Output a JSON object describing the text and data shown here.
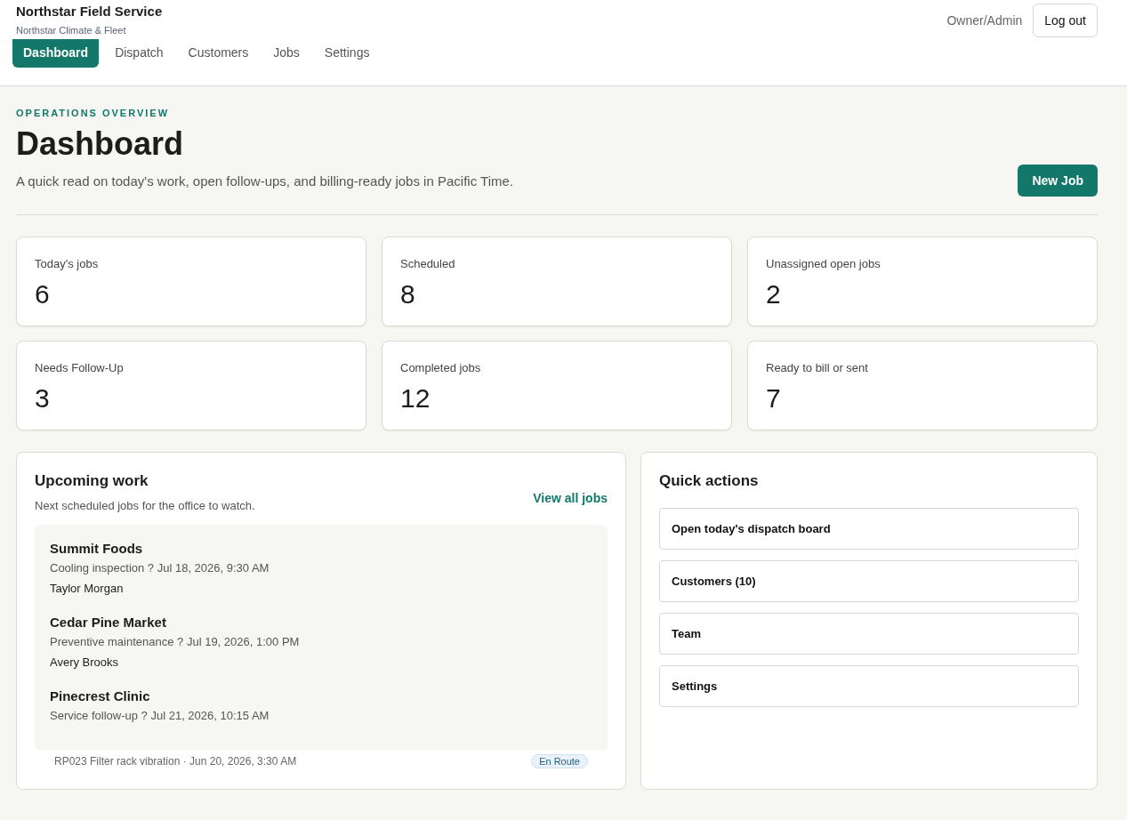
{
  "brand": {
    "title": "Northstar Field Service",
    "subtitle": "Northstar Climate & Fleet"
  },
  "user": {
    "role": "Owner/Admin",
    "logout": "Log out"
  },
  "nav": [
    {
      "label": "Dashboard",
      "selected": true
    },
    {
      "label": "Dispatch",
      "selected": false
    },
    {
      "label": "Customers",
      "selected": false
    },
    {
      "label": "Jobs",
      "selected": false
    },
    {
      "label": "Settings",
      "selected": false
    }
  ],
  "page": {
    "eyebrow": "OPERATIONS OVERVIEW",
    "title": "Dashboard",
    "description": "A quick read on today's work, open follow-ups, and billing-ready jobs in Pacific Time.",
    "action": "New Job"
  },
  "stats": [
    {
      "label": "Today's jobs",
      "value": "6"
    },
    {
      "label": "Scheduled",
      "value": "8"
    },
    {
      "label": "Unassigned open jobs",
      "value": "2"
    },
    {
      "label": "Needs Follow-Up",
      "value": "3"
    },
    {
      "label": "Completed jobs",
      "value": "12"
    },
    {
      "label": "Ready to bill or sent",
      "value": "7"
    }
  ],
  "upcoming": {
    "title": "Upcoming work",
    "subtitle": "Next scheduled jobs for the office to watch.",
    "link": "View all jobs",
    "jobs": [
      {
        "customer": "Summit Foods",
        "detail": "Cooling inspection ? Jul 18, 2026, 9:30 AM",
        "tech": "Taylor Morgan"
      },
      {
        "customer": "Cedar Pine Market",
        "detail": "Preventive maintenance ? Jul 19, 2026, 1:00 PM",
        "tech": "Avery Brooks"
      },
      {
        "customer": "Pinecrest Clinic",
        "detail": "Service follow-up ? Jul 21, 2026, 10:15 AM"
      }
    ],
    "extra": {
      "text": "RP023 Filter rack vibration · Jun 20, 2026, 3:30 AM",
      "status": "En Route"
    }
  },
  "quick_actions": {
    "title": "Quick actions",
    "items": [
      "Open today's dispatch board",
      "Customers (10)",
      "Team",
      "Settings"
    ]
  }
}
